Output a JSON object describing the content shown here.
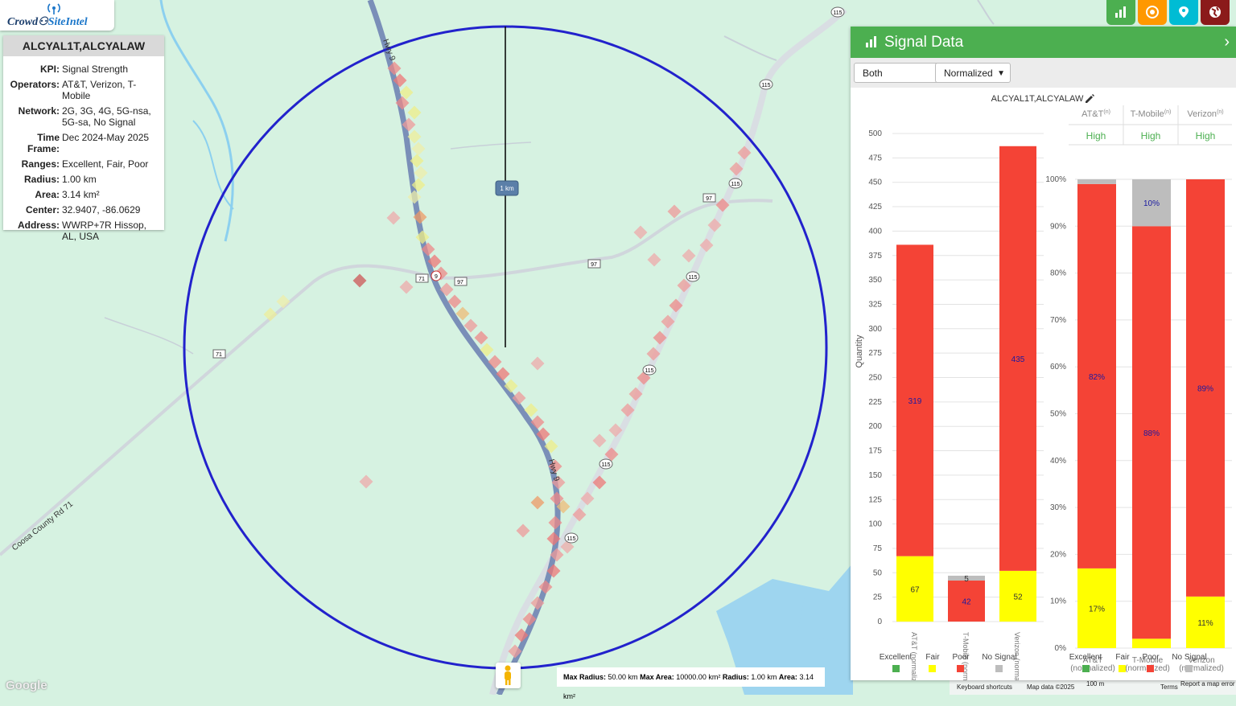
{
  "app": {
    "logo_left": "Crowd",
    "logo_right": "SiteIntel"
  },
  "info_panel": {
    "title": "ALCYAL1T,ALCYALAW",
    "rows": [
      {
        "k": "KPI:",
        "v": "Signal Strength"
      },
      {
        "k": "Operators:",
        "v": "AT&T, Verizon, T-Mobile"
      },
      {
        "k": "Network:",
        "v": "2G, 3G, 4G, 5G-nsa, 5G-sa, No Signal"
      },
      {
        "k": "Time Frame:",
        "v": "Dec 2024-May 2025"
      },
      {
        "k": "Ranges:",
        "v": "Excellent, Fair, Poor"
      },
      {
        "k": "Radius:",
        "v": "1.00 km"
      },
      {
        "k": "Area:",
        "v": "3.14 km²"
      },
      {
        "k": "Center:",
        "v": "32.9407, -86.0629"
      },
      {
        "k": "Address:",
        "v": "WWRP+7R Hissop, AL, USA"
      }
    ]
  },
  "map": {
    "radius_label": "1 km",
    "road_labels": {
      "hwy9_top": "Hwy 9",
      "hwy9_mid": "Hwy 9",
      "county_rd": "Coosa County Rd 71"
    },
    "shields": {
      "r115": "115",
      "r97": "97",
      "r71": "71",
      "r9": "9"
    },
    "scale_info": {
      "max_radius_k": "Max Radius:",
      "max_radius_v": "50.00 km",
      "max_area_k": "Max Area:",
      "max_area_v": "10000.00 km²",
      "radius_k": "Radius:",
      "radius_v": "1.00 km",
      "area_k": "Area:",
      "area_v": "3.14 km²"
    },
    "google": "Google",
    "footer": {
      "shortcuts": "Keyboard shortcuts",
      "mapdata": "Map data ©2025",
      "scale": "100 m",
      "terms": "Terms",
      "report": "Report a map error"
    }
  },
  "top_buttons": [
    {
      "name": "chart-icon",
      "color": "#4caf50"
    },
    {
      "name": "target-icon",
      "color": "#ff9800"
    },
    {
      "name": "map-pin-icon",
      "color": "#00bcd4"
    },
    {
      "name": "globe-icon",
      "color": "#8b1a1a"
    }
  ],
  "signal_panel": {
    "title": "Signal Data",
    "operator_select": "Both",
    "mode_select": "Normalized",
    "chart_title": "ALCYAL1T,ALCYALAW",
    "left_ylabel": "Quantity",
    "right_headers": [
      {
        "name": "AT&T",
        "sup": "(n)",
        "level": "High"
      },
      {
        "name": "T-Mobile",
        "sup": "(n)",
        "level": "High"
      },
      {
        "name": "Verizon",
        "sup": "(n)",
        "level": "High"
      }
    ],
    "legend": [
      "Excellent",
      "Fair",
      "Poor",
      "No Signal"
    ],
    "colors": {
      "excellent": "#4caf50",
      "fair": "#ffff00",
      "poor": "#f44336",
      "nosignal": "#bdbdbd",
      "circle": "#2222cc"
    }
  },
  "chart_data": [
    {
      "type": "bar",
      "stacked": true,
      "title": "ALCYAL1T,ALCYALAW",
      "ylabel": "Quantity",
      "ylim": [
        0,
        500
      ],
      "yticks": [
        0,
        25,
        50,
        75,
        100,
        125,
        150,
        175,
        200,
        225,
        250,
        275,
        300,
        325,
        350,
        375,
        400,
        425,
        450,
        475,
        500
      ],
      "categories": [
        "AT&T (normalized)",
        "T-Mobile (normalized)",
        "Verizon (normalized)"
      ],
      "series": [
        {
          "name": "Fair",
          "values": [
            67,
            0,
            52
          ],
          "labels": [
            "67",
            "",
            "52"
          ]
        },
        {
          "name": "Poor",
          "values": [
            319,
            42,
            435
          ],
          "labels": [
            "319",
            "42",
            "435"
          ]
        },
        {
          "name": "No Signal",
          "values": [
            0,
            5,
            0
          ],
          "labels": [
            "",
            "5",
            ""
          ]
        }
      ]
    },
    {
      "type": "bar",
      "stacked": true,
      "ylim": [
        0,
        100
      ],
      "yticks": [
        "0%",
        "10%",
        "20%",
        "30%",
        "40%",
        "50%",
        "60%",
        "70%",
        "80%",
        "90%",
        "100%"
      ],
      "categories": [
        "AT&T (normalized)",
        "T-Mobile (normalized)",
        "Verizon (normalized)"
      ],
      "series": [
        {
          "name": "Fair",
          "values": [
            17,
            2,
            11
          ],
          "labels": [
            "17%",
            "",
            "11%"
          ]
        },
        {
          "name": "Poor",
          "values": [
            82,
            88,
            89
          ],
          "labels": [
            "82%",
            "88%",
            "89%"
          ]
        },
        {
          "name": "No Signal",
          "values": [
            1,
            10,
            0
          ],
          "labels": [
            "",
            "10%",
            ""
          ]
        }
      ]
    }
  ]
}
